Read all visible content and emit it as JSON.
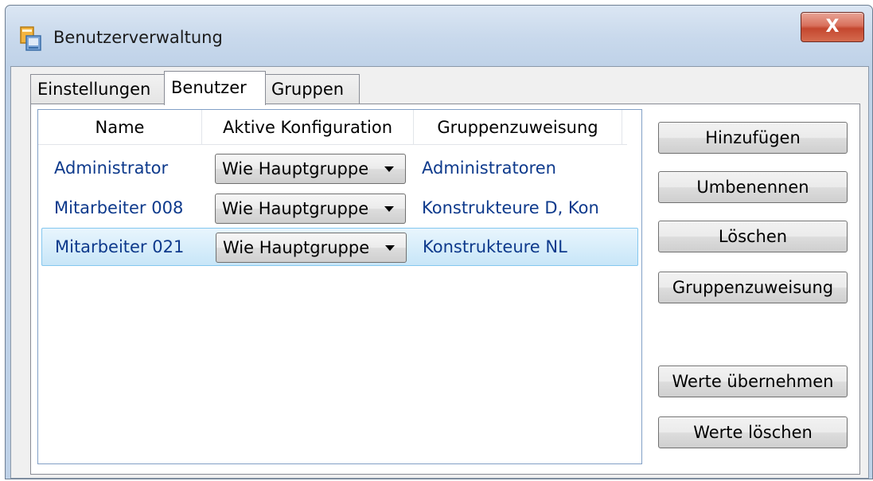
{
  "window": {
    "title": "Benutzerverwaltung",
    "close_glyph": "X",
    "app_icon": "user-admin-icon"
  },
  "tabs": [
    {
      "label": "Einstellungen"
    },
    {
      "label": "Benutzer",
      "active": true
    },
    {
      "label": "Gruppen"
    }
  ],
  "list": {
    "columns": [
      "Name",
      "Aktive Konfiguration",
      "Gruppenzuweisung"
    ],
    "rows": [
      {
        "name": "Administrator",
        "config": "Wie Hauptgruppe",
        "group": "Administratoren",
        "selected": false
      },
      {
        "name": "Mitarbeiter 008",
        "config": "Wie Hauptgruppe",
        "group": "Konstrukteure D, Kon",
        "selected": false
      },
      {
        "name": "Mitarbeiter 021",
        "config": "Wie Hauptgruppe",
        "group": "Konstrukteure NL",
        "selected": true
      }
    ]
  },
  "buttons": {
    "add": "Hinzufügen",
    "rename": "Umbenennen",
    "delete": "Löschen",
    "assign_group": "Gruppenzuweisung",
    "apply_values": "Werte übernehmen",
    "clear_values": "Werte löschen"
  },
  "colors": {
    "link_text": "#0e3a8c",
    "selection": "#c8e6f8",
    "close": "#c4472f"
  }
}
